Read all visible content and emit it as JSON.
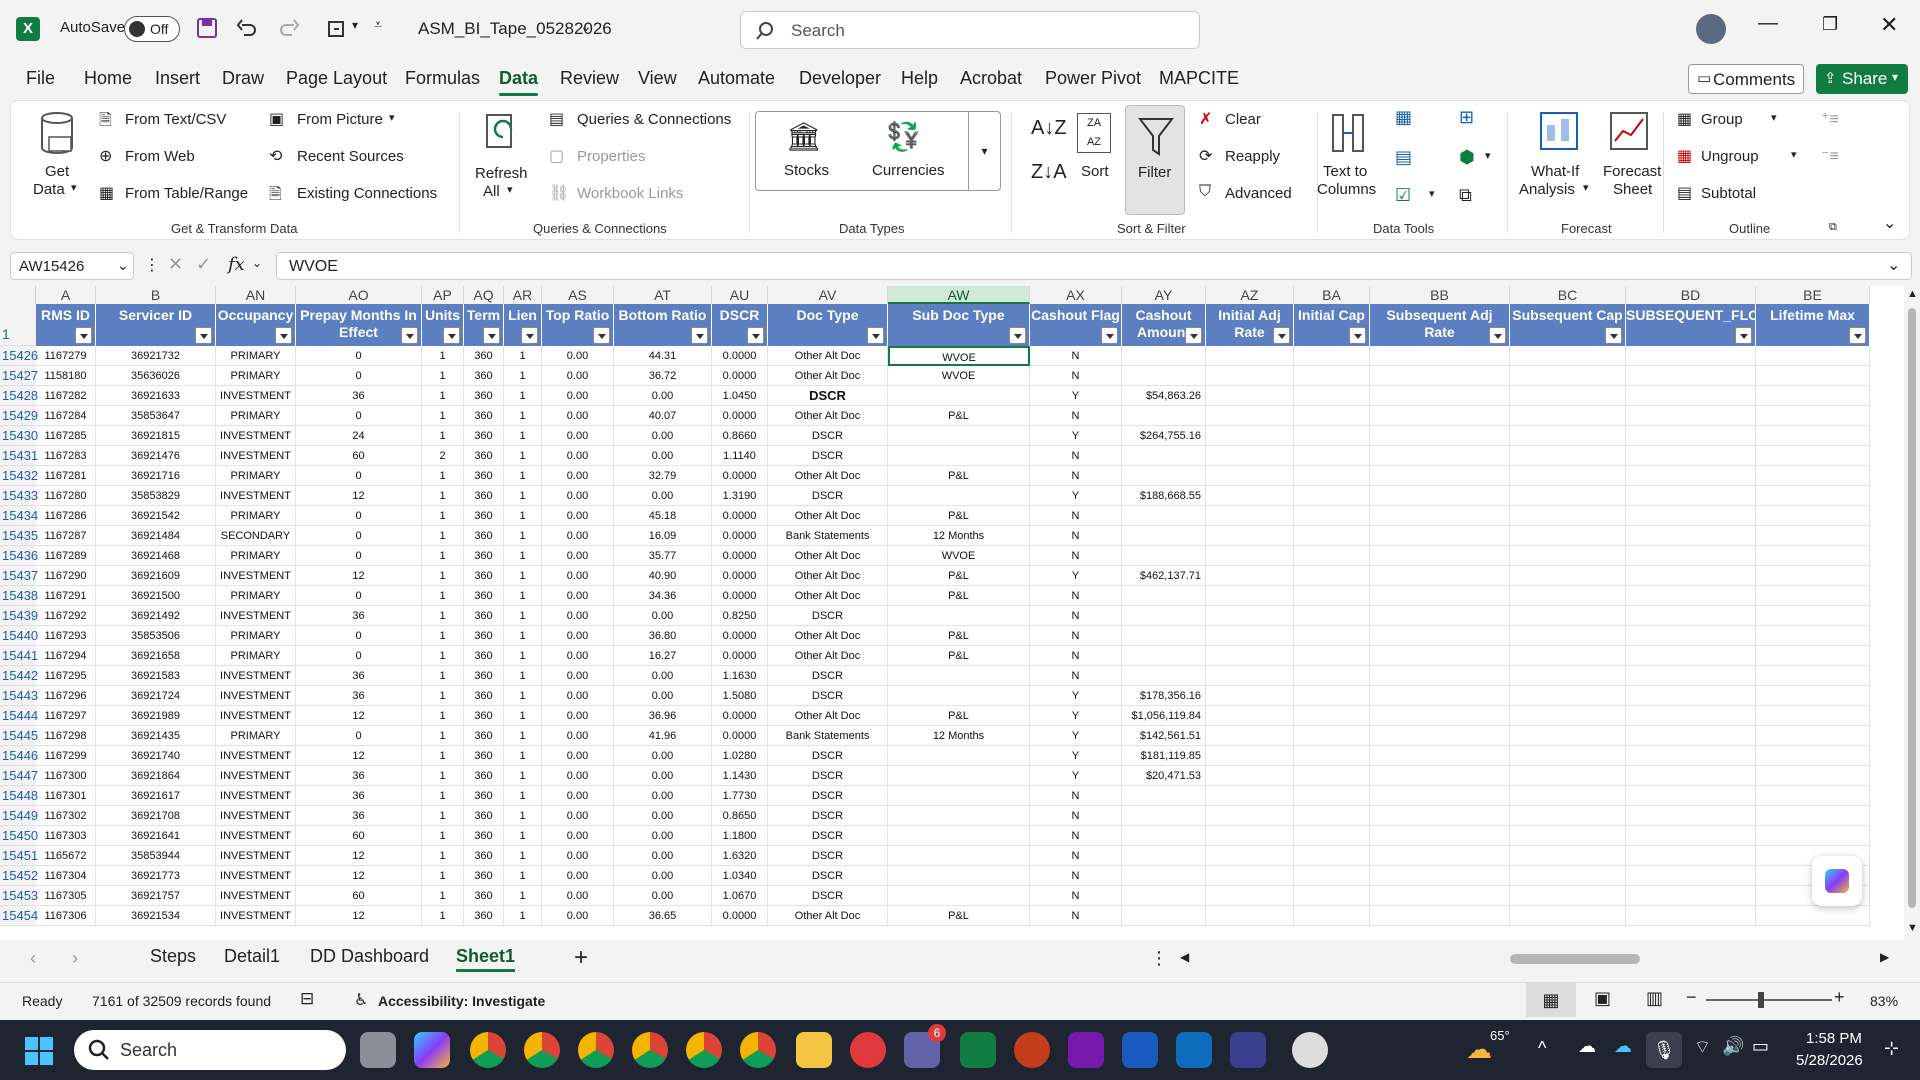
{
  "title": {
    "autosave_label": "AutoSave",
    "autosave_state": "Off",
    "filename": "ASM_BI_Tape_05282026",
    "search_placeholder": "Search"
  },
  "menu": [
    "File",
    "Home",
    "Insert",
    "Draw",
    "Page Layout",
    "Formulas",
    "Data",
    "Review",
    "View",
    "Automate",
    "Developer",
    "Help",
    "Acrobat",
    "Power Pivot",
    "MAPCITE"
  ],
  "comments_label": "Comments",
  "share_label": "Share",
  "ribbon": {
    "get_data": "Get",
    "get_data2": "Data",
    "from_text": "From Text/CSV",
    "from_web": "From Web",
    "from_table": "From Table/Range",
    "from_picture": "From Picture",
    "recent_sources": "Recent Sources",
    "existing_connections": "Existing Connections",
    "grp_get": "Get & Transform Data",
    "refresh": "Refresh",
    "refresh2": "All",
    "queries_conn": "Queries & Connections",
    "properties": "Properties",
    "workbook_links": "Workbook Links",
    "grp_queries": "Queries & Connections",
    "stocks": "Stocks",
    "currencies": "Currencies",
    "grp_types": "Data Types",
    "sort": "Sort",
    "filter": "Filter",
    "clear": "Clear",
    "reapply": "Reapply",
    "advanced": "Advanced",
    "grp_sort": "Sort & Filter",
    "text_to": "Text to",
    "columns": "Columns",
    "grp_tools": "Data Tools",
    "what_if": "What-If",
    "analysis": "Analysis",
    "forecast": "Forecast",
    "sheet": "Sheet",
    "grp_forecast": "Forecast",
    "group": "Group",
    "ungroup": "Ungroup",
    "subtotal": "Subtotal",
    "grp_outline": "Outline"
  },
  "formula": {
    "namebox": "AW15426",
    "fx": "fx",
    "value": "WVOE"
  },
  "col_letters": [
    "A",
    "B",
    "AN",
    "AO",
    "AP",
    "AQ",
    "AR",
    "AS",
    "AT",
    "AU",
    "AV",
    "AW",
    "AX",
    "AY",
    "AZ",
    "BA",
    "BB",
    "BC",
    "BD",
    "BE"
  ],
  "headers": [
    "RMS ID",
    "Servicer ID",
    "Occupancy",
    "Prepay Months In Effect",
    "Units",
    "Term",
    "Lien",
    "Top Ratio",
    "Bottom Ratio",
    "DSCR",
    "Doc Type",
    "Sub Doc Type",
    "Cashout Flag",
    "Cashout Amount",
    "Initial Adj Rate",
    "Initial Cap",
    "Subsequent Adj Rate",
    "Subsequent Cap",
    "SUBSEQUENT_FLOOR",
    "Lifetime Max"
  ],
  "header_row_num": "1",
  "rows": [
    {
      "n": "15426",
      "c": [
        "1167279",
        "36921732",
        "PRIMARY",
        "0",
        "1",
        "360",
        "1",
        "0.00",
        "44.31",
        "0.0000",
        "Other Alt Doc",
        "WVOE",
        "N",
        ""
      ]
    },
    {
      "n": "15427",
      "c": [
        "1158180",
        "35636026",
        "PRIMARY",
        "0",
        "1",
        "360",
        "1",
        "0.00",
        "36.72",
        "0.0000",
        "Other Alt Doc",
        "WVOE",
        "N",
        ""
      ]
    },
    {
      "n": "15428",
      "c": [
        "1167282",
        "36921633",
        "INVESTMENT",
        "36",
        "1",
        "360",
        "1",
        "0.00",
        "0.00",
        "1.0450",
        "DSCR",
        "",
        "Y",
        "$54,863.26"
      ]
    },
    {
      "n": "15429",
      "c": [
        "1167284",
        "35853647",
        "PRIMARY",
        "0",
        "1",
        "360",
        "1",
        "0.00",
        "40.07",
        "0.0000",
        "Other Alt Doc",
        "P&L",
        "N",
        ""
      ]
    },
    {
      "n": "15430",
      "c": [
        "1167285",
        "36921815",
        "INVESTMENT",
        "24",
        "1",
        "360",
        "1",
        "0.00",
        "0.00",
        "0.8660",
        "DSCR",
        "",
        "Y",
        "$264,755.16"
      ]
    },
    {
      "n": "15431",
      "c": [
        "1167283",
        "36921476",
        "INVESTMENT",
        "60",
        "2",
        "360",
        "1",
        "0.00",
        "0.00",
        "1.1140",
        "DSCR",
        "",
        "N",
        ""
      ]
    },
    {
      "n": "15432",
      "c": [
        "1167281",
        "36921716",
        "PRIMARY",
        "0",
        "1",
        "360",
        "1",
        "0.00",
        "32.79",
        "0.0000",
        "Other Alt Doc",
        "P&L",
        "N",
        ""
      ]
    },
    {
      "n": "15433",
      "c": [
        "1167280",
        "35853829",
        "INVESTMENT",
        "12",
        "1",
        "360",
        "1",
        "0.00",
        "0.00",
        "1.3190",
        "DSCR",
        "",
        "Y",
        "$188,668.55"
      ]
    },
    {
      "n": "15434",
      "c": [
        "1167286",
        "36921542",
        "PRIMARY",
        "0",
        "1",
        "360",
        "1",
        "0.00",
        "45.18",
        "0.0000",
        "Other Alt Doc",
        "P&L",
        "N",
        ""
      ]
    },
    {
      "n": "15435",
      "c": [
        "1167287",
        "36921484",
        "SECONDARY",
        "0",
        "1",
        "360",
        "1",
        "0.00",
        "16.09",
        "0.0000",
        "Bank Statements",
        "12 Months",
        "N",
        ""
      ]
    },
    {
      "n": "15436",
      "c": [
        "1167289",
        "36921468",
        "PRIMARY",
        "0",
        "1",
        "360",
        "1",
        "0.00",
        "35.77",
        "0.0000",
        "Other Alt Doc",
        "WVOE",
        "N",
        ""
      ]
    },
    {
      "n": "15437",
      "c": [
        "1167290",
        "36921609",
        "INVESTMENT",
        "12",
        "1",
        "360",
        "1",
        "0.00",
        "40.90",
        "0.0000",
        "Other Alt Doc",
        "P&L",
        "Y",
        "$462,137.71"
      ]
    },
    {
      "n": "15438",
      "c": [
        "1167291",
        "36921500",
        "PRIMARY",
        "0",
        "1",
        "360",
        "1",
        "0.00",
        "34.36",
        "0.0000",
        "Other Alt Doc",
        "P&L",
        "N",
        ""
      ]
    },
    {
      "n": "15439",
      "c": [
        "1167292",
        "36921492",
        "INVESTMENT",
        "36",
        "1",
        "360",
        "1",
        "0.00",
        "0.00",
        "0.8250",
        "DSCR",
        "",
        "N",
        ""
      ]
    },
    {
      "n": "15440",
      "c": [
        "1167293",
        "35853506",
        "PRIMARY",
        "0",
        "1",
        "360",
        "1",
        "0.00",
        "36.80",
        "0.0000",
        "Other Alt Doc",
        "P&L",
        "N",
        ""
      ]
    },
    {
      "n": "15441",
      "c": [
        "1167294",
        "36921658",
        "PRIMARY",
        "0",
        "1",
        "360",
        "1",
        "0.00",
        "16.27",
        "0.0000",
        "Other Alt Doc",
        "P&L",
        "N",
        ""
      ]
    },
    {
      "n": "15442",
      "c": [
        "1167295",
        "36921583",
        "INVESTMENT",
        "36",
        "1",
        "360",
        "1",
        "0.00",
        "0.00",
        "1.1630",
        "DSCR",
        "",
        "N",
        ""
      ]
    },
    {
      "n": "15443",
      "c": [
        "1167296",
        "36921724",
        "INVESTMENT",
        "36",
        "1",
        "360",
        "1",
        "0.00",
        "0.00",
        "1.5080",
        "DSCR",
        "",
        "Y",
        "$178,356.16"
      ]
    },
    {
      "n": "15444",
      "c": [
        "1167297",
        "36921989",
        "INVESTMENT",
        "12",
        "1",
        "360",
        "1",
        "0.00",
        "36.96",
        "0.0000",
        "Other Alt Doc",
        "P&L",
        "Y",
        "$1,056,119.84"
      ]
    },
    {
      "n": "15445",
      "c": [
        "1167298",
        "36921435",
        "PRIMARY",
        "0",
        "1",
        "360",
        "1",
        "0.00",
        "41.96",
        "0.0000",
        "Bank Statements",
        "12 Months",
        "Y",
        "$142,561.51"
      ]
    },
    {
      "n": "15446",
      "c": [
        "1167299",
        "36921740",
        "INVESTMENT",
        "12",
        "1",
        "360",
        "1",
        "0.00",
        "0.00",
        "1.0280",
        "DSCR",
        "",
        "Y",
        "$181,119.85"
      ]
    },
    {
      "n": "15447",
      "c": [
        "1167300",
        "36921864",
        "INVESTMENT",
        "36",
        "1",
        "360",
        "1",
        "0.00",
        "0.00",
        "1.1430",
        "DSCR",
        "",
        "Y",
        "$20,471.53"
      ]
    },
    {
      "n": "15448",
      "c": [
        "1167301",
        "36921617",
        "INVESTMENT",
        "36",
        "1",
        "360",
        "1",
        "0.00",
        "0.00",
        "1.7730",
        "DSCR",
        "",
        "N",
        ""
      ]
    },
    {
      "n": "15449",
      "c": [
        "1167302",
        "36921708",
        "INVESTMENT",
        "36",
        "1",
        "360",
        "1",
        "0.00",
        "0.00",
        "0.8650",
        "DSCR",
        "",
        "N",
        ""
      ]
    },
    {
      "n": "15450",
      "c": [
        "1167303",
        "36921641",
        "INVESTMENT",
        "60",
        "1",
        "360",
        "1",
        "0.00",
        "0.00",
        "1.1800",
        "DSCR",
        "",
        "N",
        ""
      ]
    },
    {
      "n": "15451",
      "c": [
        "1165672",
        "35853944",
        "INVESTMENT",
        "12",
        "1",
        "360",
        "1",
        "0.00",
        "0.00",
        "1.6320",
        "DSCR",
        "",
        "N",
        ""
      ]
    },
    {
      "n": "15452",
      "c": [
        "1167304",
        "36921773",
        "INVESTMENT",
        "12",
        "1",
        "360",
        "1",
        "0.00",
        "0.00",
        "1.0340",
        "DSCR",
        "",
        "N",
        ""
      ]
    },
    {
      "n": "15453",
      "c": [
        "1167305",
        "36921757",
        "INVESTMENT",
        "60",
        "1",
        "360",
        "1",
        "0.00",
        "0.00",
        "1.0670",
        "DSCR",
        "",
        "N",
        ""
      ]
    },
    {
      "n": "15454",
      "c": [
        "1167306",
        "36921534",
        "INVESTMENT",
        "12",
        "1",
        "360",
        "1",
        "0.00",
        "36.65",
        "0.0000",
        "Other Alt Doc",
        "P&L",
        "N",
        ""
      ]
    }
  ],
  "sheets": [
    "Steps",
    "Detail1",
    "DD Dashboard",
    "Sheet1"
  ],
  "active_sheet": "Sheet1",
  "status": {
    "ready": "Ready",
    "records": "7161 of 32509 records found",
    "accessibility": "Accessibility: Investigate",
    "zoom": "83%"
  },
  "taskbar": {
    "search": "Search",
    "temp": "65°",
    "time": "1:58 PM",
    "date": "5/28/2026",
    "teams_badge": "6"
  },
  "colors": {
    "accent": "#107c41",
    "header_blue": "#5b7fc0",
    "rownum": "#1a5fb4"
  }
}
